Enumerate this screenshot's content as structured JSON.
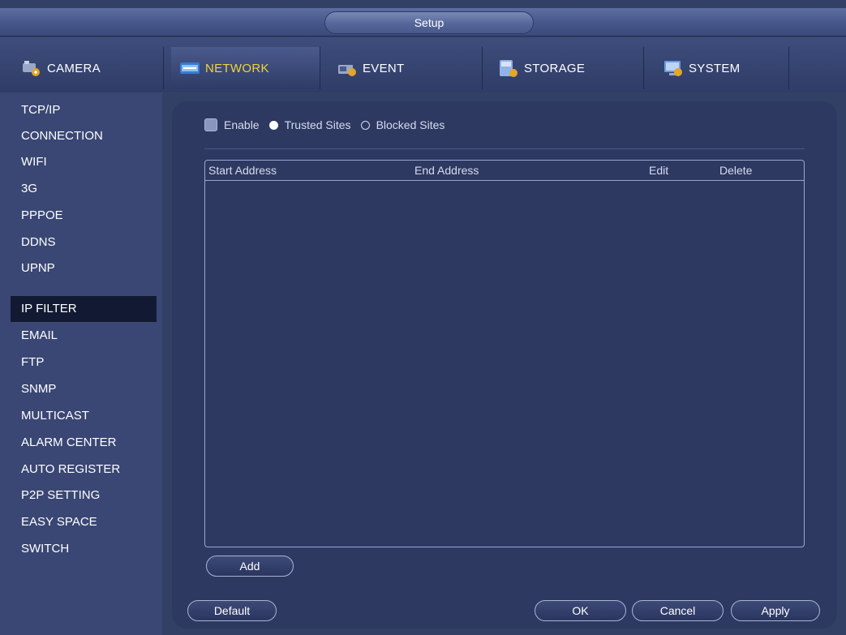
{
  "window": {
    "title": "Setup"
  },
  "tabs": [
    {
      "label": "CAMERA",
      "icon": "camera-icon",
      "active": false
    },
    {
      "label": "NETWORK",
      "icon": "network-icon",
      "active": true
    },
    {
      "label": "EVENT",
      "icon": "event-icon",
      "active": false
    },
    {
      "label": "STORAGE",
      "icon": "storage-icon",
      "active": false
    },
    {
      "label": "SYSTEM",
      "icon": "system-icon",
      "active": false
    }
  ],
  "sidebar": {
    "items": [
      {
        "label": "TCP/IP"
      },
      {
        "label": "CONNECTION"
      },
      {
        "label": "WIFI"
      },
      {
        "label": "3G"
      },
      {
        "label": "PPPOE"
      },
      {
        "label": "DDNS"
      },
      {
        "label": "UPNP"
      },
      {
        "label": "IP FILTER",
        "active": true
      },
      {
        "label": "EMAIL"
      },
      {
        "label": "FTP"
      },
      {
        "label": "SNMP"
      },
      {
        "label": "MULTICAST"
      },
      {
        "label": "ALARM CENTER"
      },
      {
        "label": "AUTO REGISTER"
      },
      {
        "label": "P2P SETTING"
      },
      {
        "label": "EASY SPACE"
      },
      {
        "label": "SWITCH"
      }
    ]
  },
  "filter": {
    "enable_label": "Enable",
    "enable_checked": false,
    "trusted_label": "Trusted Sites",
    "blocked_label": "Blocked Sites",
    "selected": "Trusted Sites"
  },
  "table": {
    "headers": [
      "Start Address",
      "End Address",
      "Edit",
      "Delete"
    ],
    "rows": []
  },
  "buttons": {
    "add": "Add",
    "default": "Default",
    "ok": "OK",
    "cancel": "Cancel",
    "apply": "Apply"
  },
  "colors": {
    "active_tab_text": "#f2d23a",
    "background": "#334065",
    "panel": "#2d3961"
  }
}
